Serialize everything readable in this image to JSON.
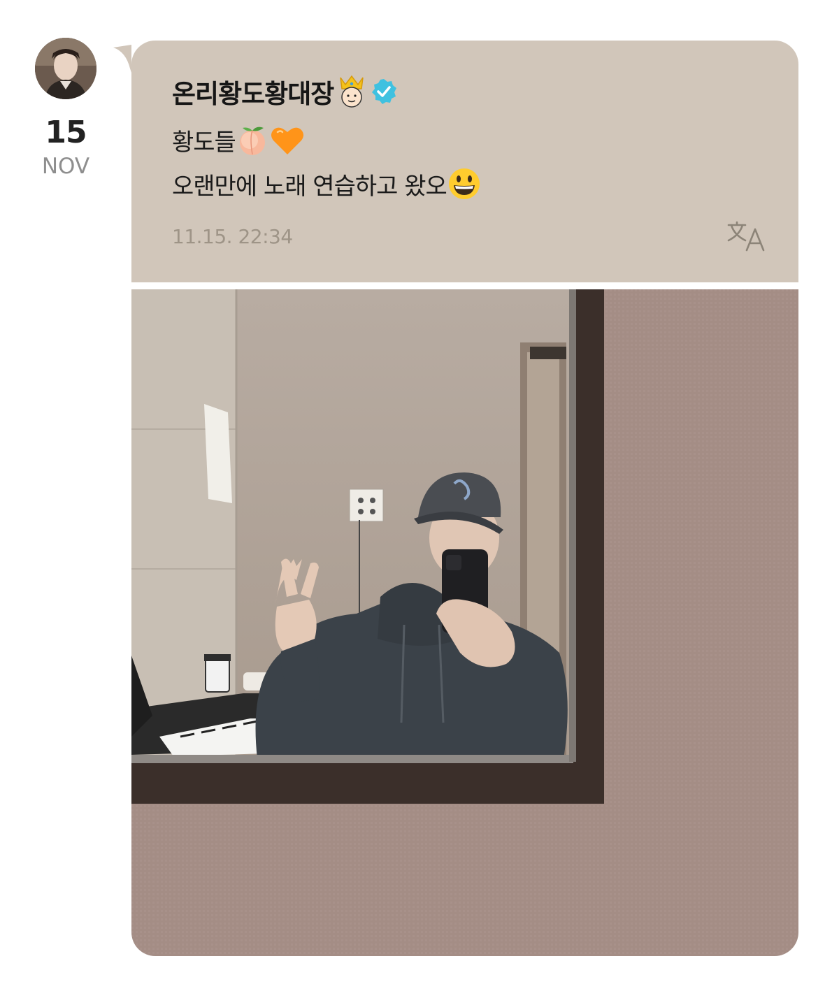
{
  "post": {
    "author": {
      "name": "온리황도황대장",
      "badge_emoji": "crown-boy-emoji",
      "verified_icon": "verified-check-icon"
    },
    "date": {
      "day": "15",
      "month": "NOV"
    },
    "lines": [
      {
        "text": "황도들",
        "emojis": [
          "peach-emoji",
          "orange-heart-emoji"
        ]
      },
      {
        "text": "오랜만에 노래 연습하고 왔오",
        "emojis": [
          "grinning-face-emoji"
        ]
      }
    ],
    "timestamp": "11.15. 22:34",
    "translate_icon": "translate-icon",
    "photo": "mirror-selfie-photo"
  },
  "colors": {
    "bubble_bg": "#d1c6ba",
    "verified": "#3fc1e0",
    "timestamp": "#9e9487",
    "wall": "#a58e86"
  }
}
